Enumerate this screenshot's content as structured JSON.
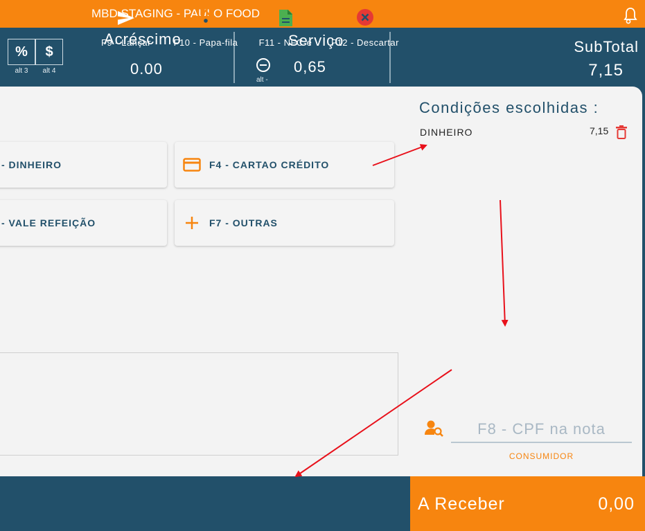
{
  "app": {
    "title": "MBD STAGING - PAULO FOOD"
  },
  "header": {
    "discount_percent": {
      "symbol": "%",
      "shortcut": "alt 3"
    },
    "discount_value": {
      "symbol": "$",
      "shortcut": "alt 4"
    },
    "acrescimo": {
      "label": "Acréscimo",
      "value": "0.00"
    },
    "servico": {
      "label": "Serviço",
      "value": "0,65",
      "shortcut": "alt -"
    },
    "subtotal": {
      "label": "SubTotal",
      "value": "7,15"
    }
  },
  "payment_methods": [
    {
      "label": "- DINHEIRO"
    },
    {
      "label": "F4 - CARTAO CRÉDITO",
      "icon": "credit-card-icon"
    },
    {
      "label": "- VALE REFEIÇÃO"
    },
    {
      "label": "F7 - OUTRAS",
      "icon": "plus-icon"
    }
  ],
  "conditions": {
    "title": "Condições escolhidas :",
    "items": [
      {
        "name": "DINHEIRO",
        "value": "7,15"
      }
    ]
  },
  "cpf": {
    "placeholder": "F8 - CPF na nota",
    "caption": "CONSUMIDOR"
  },
  "footer": {
    "buttons": [
      {
        "label": "F9 - Lançar",
        "icon": "send-icon"
      },
      {
        "label": "F10 - Papa-fila",
        "icon": "basket-icon"
      },
      {
        "label": "F11 - NFC-e",
        "icon": "document-icon"
      },
      {
        "label": "F12 - Descartar",
        "icon": "close-circle-icon"
      }
    ],
    "receive": {
      "label": "A Receber",
      "value": "0,00"
    }
  },
  "colors": {
    "orange": "#f7850f",
    "navy": "#22506a",
    "green": "#4caf50",
    "red": "#e53935",
    "annotation_arrow": "#e8101a"
  }
}
